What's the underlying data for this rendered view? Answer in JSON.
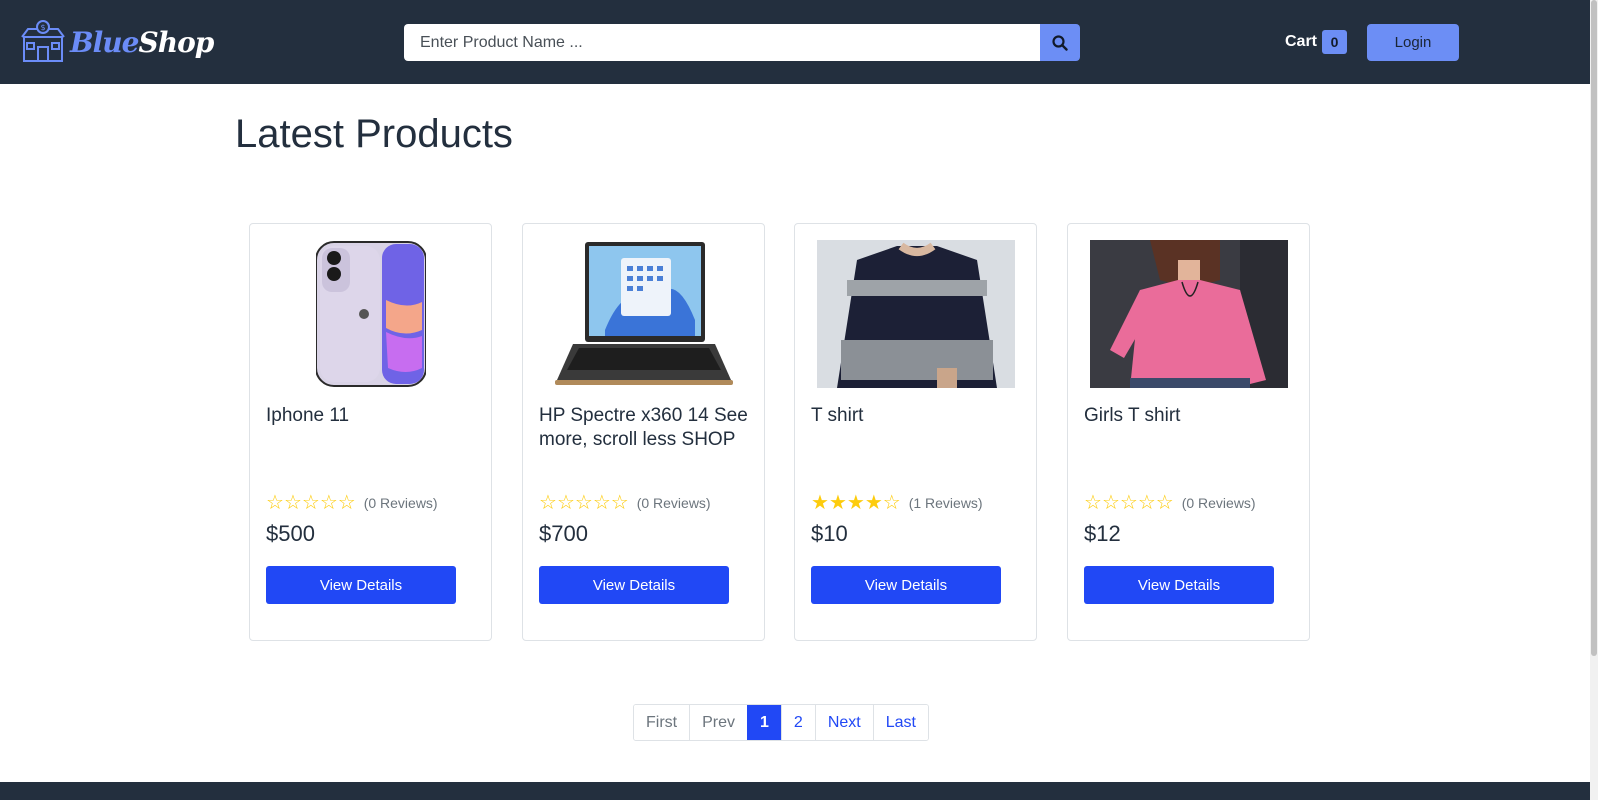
{
  "header": {
    "brand_blue": "Blue",
    "brand_shop": "Shop",
    "search_placeholder": "Enter Product Name ...",
    "cart_label": "Cart",
    "cart_count": "0",
    "login_label": "Login"
  },
  "main": {
    "heading": "Latest Products",
    "products": [
      {
        "title": "Iphone 11",
        "rating": 0,
        "reviews": "(0 Reviews)",
        "price": "$500",
        "button": "View Details",
        "image": "phone-image"
      },
      {
        "title": "HP Spectre x360 14 See more, scroll less SHOP",
        "rating": 0,
        "reviews": "(0 Reviews)",
        "price": "$700",
        "button": "View Details",
        "image": "laptop-image"
      },
      {
        "title": "T shirt",
        "rating": 4,
        "reviews": "(1 Reviews)",
        "price": "$10",
        "button": "View Details",
        "image": "tshirt-image"
      },
      {
        "title": "Girls T shirt",
        "rating": 0,
        "reviews": "(0 Reviews)",
        "price": "$12",
        "button": "View Details",
        "image": "girls-tshirt-image"
      }
    ]
  },
  "pagination": {
    "first": "First",
    "prev": "Prev",
    "page1": "1",
    "page2": "2",
    "next": "Next",
    "last": "Last"
  },
  "colors": {
    "navbar": "#232f3e",
    "accent": "#6c8ef5",
    "primary_button": "#2148f5",
    "star": "#fdcc0d"
  }
}
